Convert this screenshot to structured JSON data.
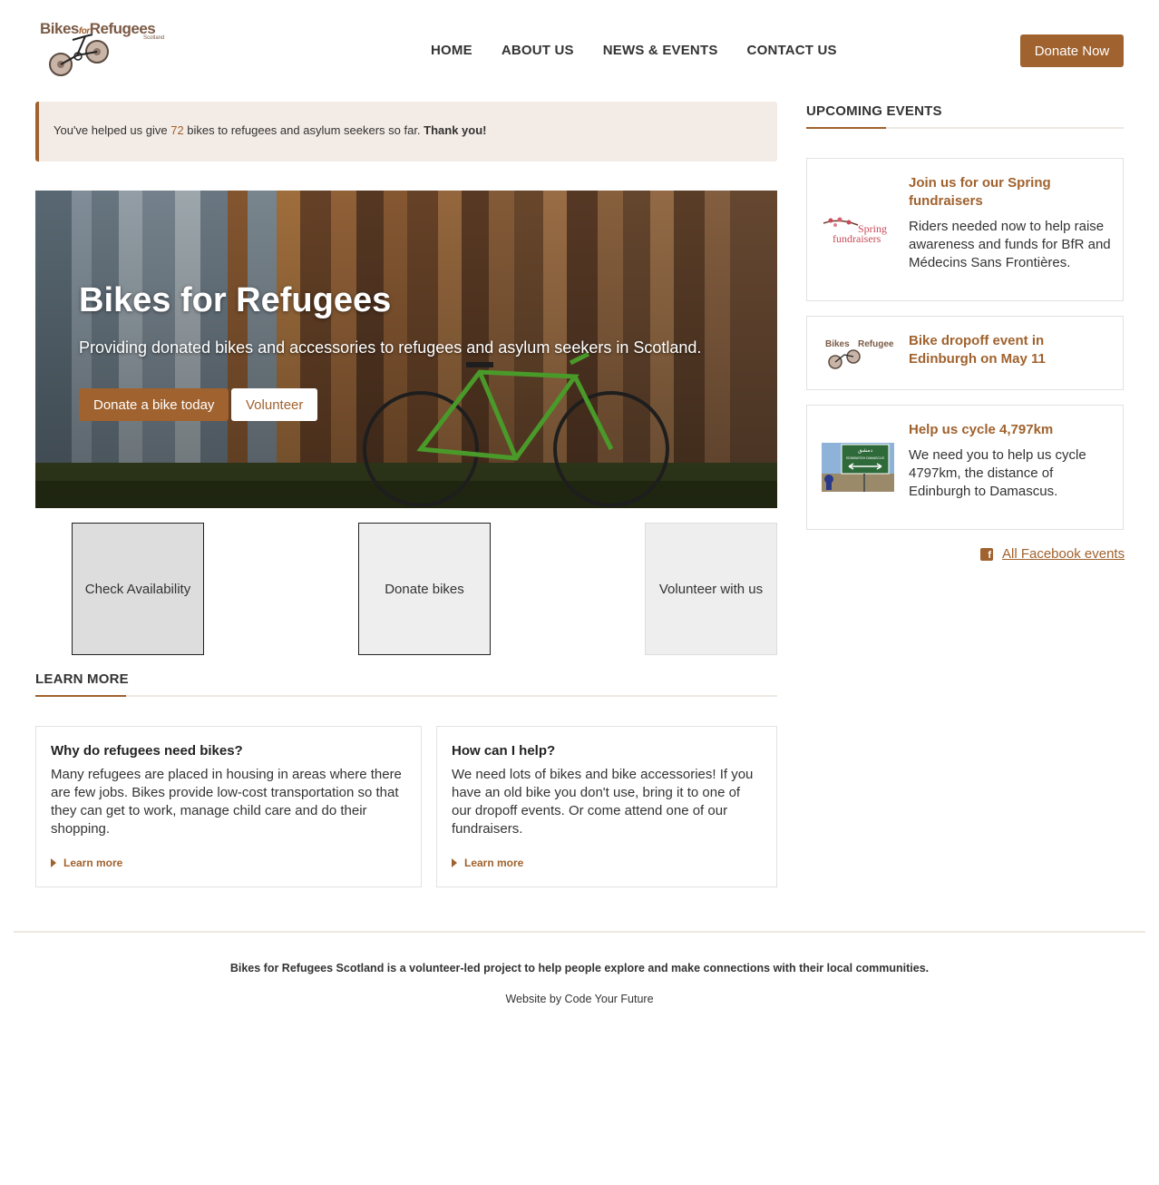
{
  "brand": {
    "logo_word_1": "Bikes",
    "logo_word_for": "for",
    "logo_word_2": "Refugees",
    "logo_sub": "Scotland",
    "accent_color": "#a0622e"
  },
  "nav": {
    "items": [
      {
        "label": "HOME"
      },
      {
        "label": "ABOUT US"
      },
      {
        "label": "NEWS & EVENTS"
      },
      {
        "label": "CONTACT US"
      }
    ],
    "donate_label": "Donate Now"
  },
  "notice": {
    "prefix": "You've helped us give ",
    "count": "72",
    "suffix": " bikes to refugees and asylum seekers so far. ",
    "thanks": "Thank you!"
  },
  "hero": {
    "title": "Bikes for Refugees",
    "subtitle": "Providing donated bikes and accessories to refugees and asylum seekers in Scotland.",
    "primary_button": "Donate a bike today",
    "secondary_button": "Volunteer"
  },
  "tiles": [
    {
      "label": "Check Availability"
    },
    {
      "label": "Donate bikes"
    },
    {
      "label": "Volunteer with us"
    }
  ],
  "learn_more": {
    "heading": "LEARN MORE",
    "cards": [
      {
        "title": "Why do refugees need bikes?",
        "body": "Many refugees are placed in housing in areas where there are few jobs. Bikes provide low-cost transportation so that they can get to work, manage child care and do their shopping.",
        "link": "Learn more"
      },
      {
        "title": "How can I help?",
        "body": "We need lots of bikes and bike accessories! If you have an old bike you don't use, bring it to one of our dropoff events. Or come attend one of our fundraisers.",
        "link": "Learn more"
      }
    ]
  },
  "events": {
    "heading": "UPCOMING EVENTS",
    "items": [
      {
        "title": "Join us for our Spring fundraisers",
        "body": "Riders needed now to help raise awareness and funds for BfR and Médecins Sans Frontières.",
        "thumb_line1": "Spring",
        "thumb_line2": "fundraisers"
      },
      {
        "title": "Bike dropoff event in Edinburgh on May 11",
        "thumb_line1": "Bikes",
        "thumb_line2": "Refugees"
      },
      {
        "title": "Help us cycle 4,797km",
        "body": "We need you to help us cycle 4797km, the distance of Edinburgh to Damascus.",
        "thumb_line1": "دمشق",
        "thumb_line2": "EDINBURGH DAMASCUS"
      }
    ],
    "facebook_label": "All Facebook events",
    "facebook_icon": "f"
  },
  "footer": {
    "main": "Bikes for Refugees Scotland is a volunteer-led project to help people explore and make connections with their local communities.",
    "credit": "Website by Code Your Future"
  }
}
